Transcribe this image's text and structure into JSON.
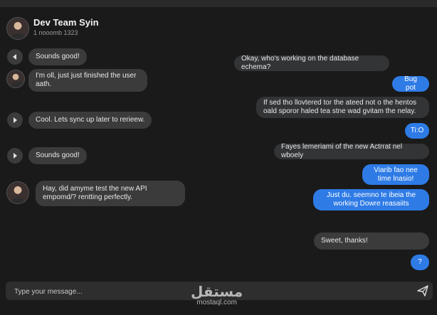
{
  "header": {
    "title": "Dev Team Syin",
    "subtitle": "1 nooomb 1323"
  },
  "messages_left": [
    {
      "text": "Sounds good!",
      "control": "back-icon"
    },
    {
      "text": "I'm oll, just just finished the user aath.",
      "control": "avatar"
    },
    {
      "text": "Cool. Lets sync up later to rerieew.",
      "control": "play-icon"
    },
    {
      "text": "Sounds good!",
      "control": "play-icon"
    },
    {
      "text": "Hay, did amyme test the new API empomd/? rentting perfectly.",
      "control": "avatar"
    }
  ],
  "messages_right": [
    {
      "text": "Okay, who's working on the database echema?",
      "style": "gray"
    },
    {
      "text": "Bug pot",
      "style": "blue"
    },
    {
      "text": "If sed tho llovtered tor the ateed not o the hentos oald sporor haled tea stne wad gvitam the nelay.",
      "style": "gray"
    },
    {
      "text": "Ti:O",
      "style": "blue"
    },
    {
      "text": "Fayes lemeriami of the new Actrrat nel wboely",
      "style": "gray"
    },
    {
      "text": "Viarib fao nee time lnasio!",
      "style": "blue"
    },
    {
      "text": "Just du. seemno te ibeia the working Dowre reasaiits",
      "style": "blue"
    },
    {
      "text": "Sweet, thanks!",
      "style": "gray"
    },
    {
      "text": "?",
      "style": "blue"
    }
  ],
  "composer": {
    "placeholder": "Type your message..."
  },
  "watermark": {
    "arabic": "مستقل",
    "latin": "mostaql.com"
  },
  "colors": {
    "background": "#1a1a1a",
    "bubble_in": "#3b3b3b",
    "bubble_out": "#333436",
    "accent_blue": "#2e7be6"
  }
}
